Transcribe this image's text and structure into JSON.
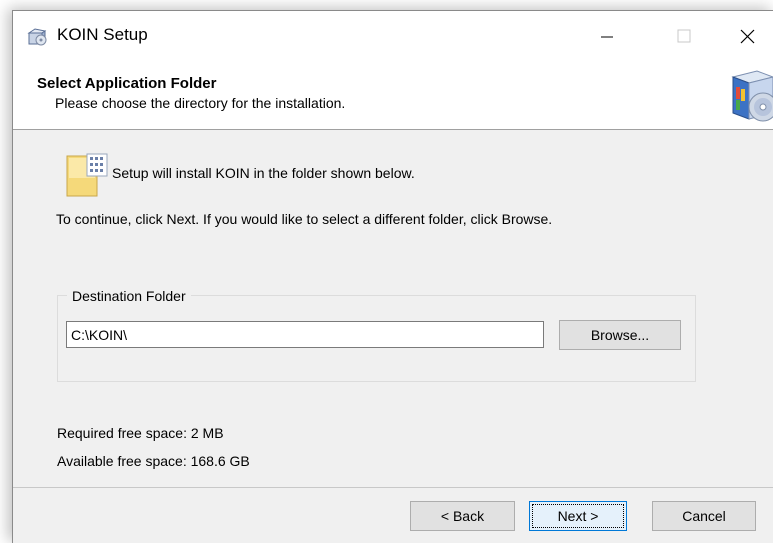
{
  "window": {
    "title": "KOIN Setup"
  },
  "icons": {
    "app": "installer-box-icon",
    "minimize": "minimize-icon",
    "maximize": "maximize-icon",
    "close": "close-icon",
    "header": "setup-box-cd-icon",
    "folder": "folder-icon"
  },
  "header": {
    "title": "Select Application Folder",
    "subtitle": "Please choose the directory for the installation."
  },
  "body": {
    "info": "Setup will install KOIN in the folder shown below.",
    "instruction": "To continue, click Next. If you would like to select a different folder, click Browse.",
    "destination": {
      "label": "Destination Folder",
      "path": "C:\\KOIN\\",
      "browse_label": "Browse..."
    },
    "required_space": "Required free space: 2 MB",
    "available_space": "Available free space: 168.6 GB"
  },
  "footer": {
    "back_label": "< Back",
    "next_label": "Next >",
    "cancel_label": "Cancel"
  },
  "colors": {
    "accent": "#0078d7",
    "dialog_bg": "#f0f0f0",
    "header_bg": "#ffffff"
  }
}
